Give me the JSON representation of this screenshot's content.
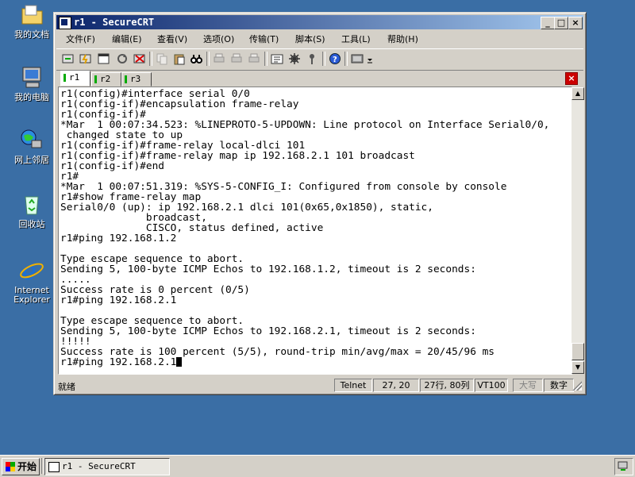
{
  "desktop": {
    "icons": [
      {
        "label": "我的文档",
        "icon": "my-documents-icon"
      },
      {
        "label": "我的电脑",
        "icon": "my-computer-icon"
      },
      {
        "label": "网上邻居",
        "icon": "network-places-icon"
      },
      {
        "label": "回收站",
        "icon": "recycle-bin-icon"
      },
      {
        "label1": "Internet",
        "label2": "Explorer",
        "icon": "internet-explorer-icon"
      }
    ]
  },
  "window": {
    "title": "r1 - SecureCRT",
    "controls": {
      "minimize": "_",
      "maximize": "□",
      "close": "×"
    }
  },
  "menu": [
    "文件(F)",
    "编辑(E)",
    "查看(V)",
    "选项(O)",
    "传输(T)",
    "脚本(S)",
    "工具(L)",
    "帮助(H)"
  ],
  "tabs": [
    {
      "label": "r1",
      "active": true
    },
    {
      "label": "r2",
      "active": false
    },
    {
      "label": "r3",
      "active": false
    }
  ],
  "terminal": {
    "lines": [
      "r1(config)#interface serial 0/0",
      "r1(config-if)#encapsulation frame-relay",
      "r1(config-if)#",
      "*Mar  1 00:07:34.523: %LINEPROTO-5-UPDOWN: Line protocol on Interface Serial0/0,",
      " changed state to up",
      "r1(config-if)#frame-relay local-dlci 101",
      "r1(config-if)#frame-relay map ip 192.168.2.1 101 broadcast",
      "r1(config-if)#end",
      "r1#",
      "*Mar  1 00:07:51.319: %SYS-5-CONFIG_I: Configured from console by console",
      "r1#show frame-relay map",
      "Serial0/0 (up): ip 192.168.2.1 dlci 101(0x65,0x1850), static,",
      "              broadcast,",
      "              CISCO, status defined, active",
      "r1#ping 192.168.1.2",
      "",
      "Type escape sequence to abort.",
      "Sending 5, 100-byte ICMP Echos to 192.168.1.2, timeout is 2 seconds:",
      ".....",
      "Success rate is 0 percent (0/5)",
      "r1#ping 192.168.2.1",
      "",
      "Type escape sequence to abort.",
      "Sending 5, 100-byte ICMP Echos to 192.168.2.1, timeout is 2 seconds:",
      "!!!!!",
      "Success rate is 100 percent (5/5), round-trip min/avg/max = 20/45/96 ms"
    ],
    "current_line": "r1#ping 192.168.2.1"
  },
  "status": {
    "ready": "就绪",
    "protocol": "Telnet",
    "position": "27,  20",
    "size": "27行, 80列",
    "terminal_type": "VT100",
    "caps": "大写",
    "num": "数字"
  },
  "taskbar": {
    "start": "开始",
    "task": "r1 - SecureCRT"
  }
}
